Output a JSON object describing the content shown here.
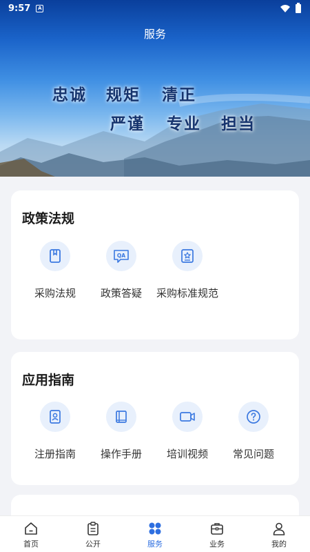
{
  "status_bar": {
    "time": "9:57"
  },
  "header": {
    "title": "服务"
  },
  "banner": {
    "line1": [
      "忠诚",
      "规矩",
      "清正"
    ],
    "line2": [
      "严谨",
      "专业",
      "担当"
    ]
  },
  "sections": [
    {
      "title": "政策法规",
      "items": [
        {
          "label": "采购法规",
          "icon": "document-icon"
        },
        {
          "label": "政策答疑",
          "icon": "qa-icon"
        },
        {
          "label": "采购标准规范",
          "icon": "standard-icon"
        }
      ]
    },
    {
      "title": "应用指南",
      "items": [
        {
          "label": "注册指南",
          "icon": "id-card-icon"
        },
        {
          "label": "操作手册",
          "icon": "manual-icon"
        },
        {
          "label": "培训视频",
          "icon": "video-icon"
        },
        {
          "label": "常见问题",
          "icon": "question-icon"
        }
      ]
    }
  ],
  "tabbar": {
    "tabs": [
      {
        "label": "首页",
        "icon": "home-icon"
      },
      {
        "label": "公开",
        "icon": "clipboard-icon"
      },
      {
        "label": "服务",
        "icon": "grid-icon",
        "active": true
      },
      {
        "label": "业务",
        "icon": "briefcase-icon"
      },
      {
        "label": "我的",
        "icon": "user-icon"
      }
    ]
  },
  "colors": {
    "accent": "#2e6fe0",
    "icon_bg": "#e8f0fc",
    "icon_stroke": "#3a78e0"
  }
}
